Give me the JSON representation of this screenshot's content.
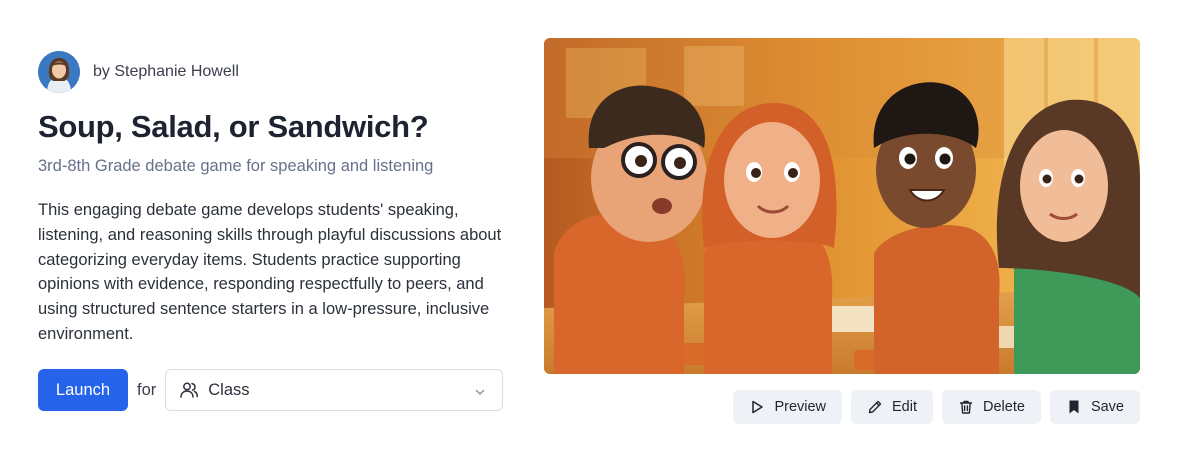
{
  "author": {
    "byline": "by Stephanie Howell"
  },
  "activity": {
    "title": "Soup, Salad, or Sandwich?",
    "subtitle": "3rd-8th Grade debate game for speaking and listening",
    "description": "This engaging debate game develops students' speaking, listening, and reasoning skills through playful discussions about categorizing everyday items. Students practice supporting opinions with evidence, responding respectfully to peers, and using structured sentence starters in a low-pressure, inclusive environment."
  },
  "launch": {
    "button_label": "Launch",
    "for_label": "for",
    "selected_option": "Class"
  },
  "actions": {
    "preview": "Preview",
    "edit": "Edit",
    "delete": "Delete",
    "save": "Save"
  },
  "icons": {
    "class": "users-icon",
    "chevron": "chevron-down-icon",
    "preview": "play-icon",
    "edit": "pencil-icon",
    "delete": "trash-icon",
    "save": "bookmark-icon"
  },
  "colors": {
    "primary": "#2563eb",
    "subtitle": "#66718a",
    "action_bg": "#eef1f5"
  }
}
